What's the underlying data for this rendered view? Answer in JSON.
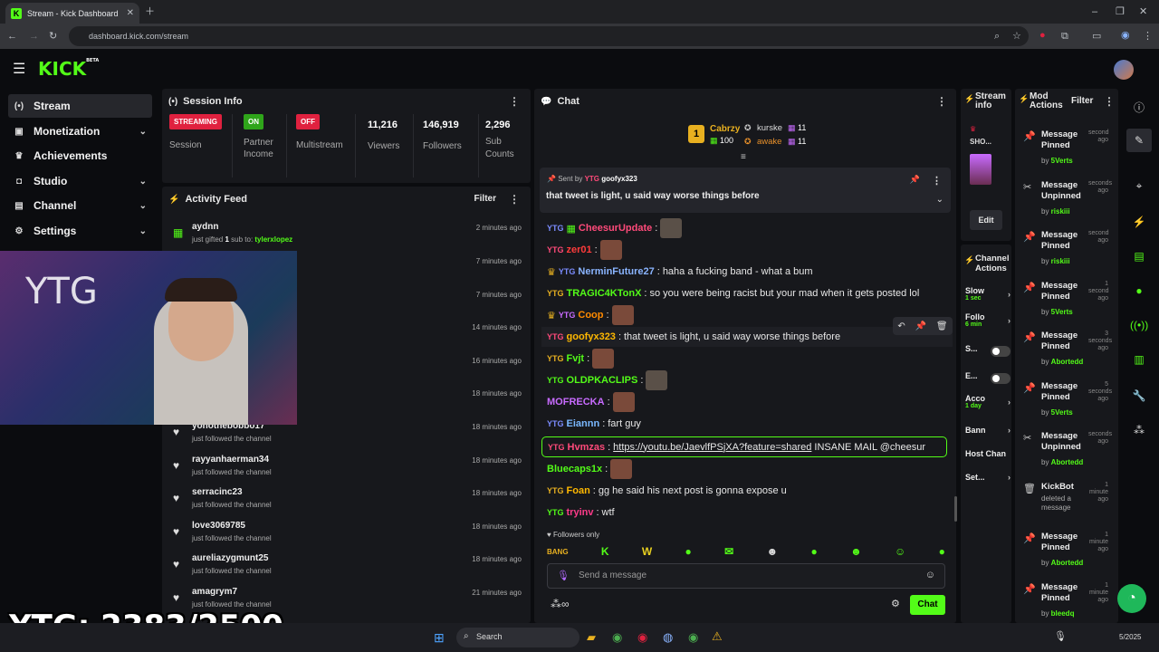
{
  "browser": {
    "tab_title": "Stream - Kick Dashboard",
    "url": "dashboard.kick.com/stream"
  },
  "app": {
    "logo": "KICK",
    "logo_badge": "BETA"
  },
  "nav": {
    "items": [
      {
        "label": "Stream",
        "icon": "broadcast-icon"
      },
      {
        "label": "Monetization",
        "icon": "wallet-icon"
      },
      {
        "label": "Achievements",
        "icon": "trophy-icon"
      },
      {
        "label": "Studio",
        "icon": "studio-icon"
      },
      {
        "label": "Channel",
        "icon": "channel-icon"
      },
      {
        "label": "Settings",
        "icon": "gear-icon"
      }
    ]
  },
  "session": {
    "title": "Session Info",
    "cells": [
      {
        "badge": "STREAMING",
        "badge_color": "#e0213f",
        "label": "Session"
      },
      {
        "badge": "ON",
        "badge_color": "#2fa51a",
        "label": "Partner Income"
      },
      {
        "badge": "OFF",
        "badge_color": "#e0213f",
        "label": "Multistream"
      },
      {
        "value": "11,216",
        "label": "Viewers"
      },
      {
        "value": "146,919",
        "label": "Followers"
      },
      {
        "value": "2,296",
        "label": "Sub Counts"
      }
    ]
  },
  "activity": {
    "title": "Activity Feed",
    "filter": "Filter",
    "items": [
      {
        "name": "aydnn",
        "sub_pre": "just gifted ",
        "sub_count": "1",
        "sub_mid": " sub to: ",
        "sub_target": "tylerxlopez",
        "time": "2 minutes ago"
      },
      {
        "time": "7 minutes ago"
      },
      {
        "time": "7 minutes ago"
      },
      {
        "time": "14 minutes ago"
      },
      {
        "time": "16 minutes ago"
      },
      {
        "time": "18 minutes ago"
      },
      {
        "name": "yohothebobbo17",
        "sub": "just followed the channel",
        "time": "18 minutes ago"
      },
      {
        "name": "rayyanhaerman34",
        "sub": "just followed the channel",
        "time": "18 minutes ago"
      },
      {
        "name": "serracinc23",
        "sub": "just followed the channel",
        "time": "18 minutes ago"
      },
      {
        "name": "love3069785",
        "sub": "just followed the channel",
        "time": "18 minutes ago"
      },
      {
        "name": "aureliazygmunt25",
        "sub": "just followed the channel",
        "time": "18 minutes ago"
      },
      {
        "name": "amagrym7",
        "sub": "just followed the channel",
        "time": "21 minutes ago"
      }
    ]
  },
  "chat": {
    "title": "Chat",
    "top_gifters": [
      {
        "name": "Cabrzy",
        "count": "100"
      },
      {
        "name": "kurske",
        "count": "11"
      },
      {
        "name": "awake",
        "count": "11"
      }
    ],
    "pinned": {
      "sent_by_label": "Sent by",
      "sender": "goofyx323",
      "message": "that tweet is light, u said way worse things before"
    },
    "messages": [
      {
        "user": "CheesurUpdate",
        "color": "#ff4a7a",
        "text": "",
        "emote": true
      },
      {
        "user": "zer01",
        "color": "#ff3b3b",
        "text": "",
        "emote": true
      },
      {
        "user": "NerminFuture27",
        "color": "#8ab4ff",
        "text": "haha a fucking band - what a bum"
      },
      {
        "user": "TRAGIC4KTonX",
        "color": "#53fc18",
        "text": "so you were being racist but your mad when it gets posted lol"
      },
      {
        "user": "Coop",
        "color": "#ff8a00",
        "text": "",
        "emote": true
      },
      {
        "user": "goofyx323",
        "color": "#ffb800",
        "text": "that tweet is light, u said way worse things before"
      },
      {
        "user": "Fvjt",
        "color": "#53fc18",
        "text": "",
        "emote": true
      },
      {
        "user": "OLDPKACLIPS",
        "color": "#53fc18",
        "text": "",
        "emote": true
      },
      {
        "user": "MOFRECKA",
        "color": "#c86bff",
        "text": "",
        "emote": true
      },
      {
        "user": "Eiannn",
        "color": "#7ab8ff",
        "text": "fart guy"
      },
      {
        "user": "Hvmzas",
        "color": "#ff4a7a",
        "link": "https://youtu.be/JaevlfPSjXA?feature=shared",
        "text": "INSANE MAIL @cheesur"
      },
      {
        "user": "Bluecaps1x",
        "color": "#53fc18",
        "text": "",
        "emote": true
      },
      {
        "user": "Foan",
        "color": "#ffb800",
        "text": "gg he said his next post is gonna expose u"
      },
      {
        "user": "tryinv",
        "color": "#ff3b8a",
        "text": "wtf"
      }
    ],
    "followers_only": "Followers only",
    "input_placeholder": "Send a message",
    "send_button": "Chat"
  },
  "stream_info": {
    "title": "Stream info",
    "snippet": "SHO...",
    "edit": "Edit"
  },
  "channel_actions": {
    "title": "Channel Actions",
    "controls": [
      {
        "label": "Slow",
        "value": "1 sec",
        "kind": "arrow"
      },
      {
        "label": "Follo",
        "value": "6 min",
        "kind": "arrow"
      },
      {
        "label": "S...",
        "kind": "toggle"
      },
      {
        "label": "E...",
        "kind": "toggle"
      },
      {
        "label": "Acco",
        "value": "1 day",
        "kind": "arrow"
      },
      {
        "label": "Bann",
        "kind": "arrow"
      },
      {
        "label": "Host Chan",
        "kind": "none"
      },
      {
        "label": "Set...",
        "kind": "arrow"
      }
    ]
  },
  "mod_actions": {
    "title": "Mod Actions",
    "filter": "Filter",
    "items": [
      {
        "action": "Message Pinned",
        "by": "5Verts",
        "time": "second ago",
        "icon": "pin-icon"
      },
      {
        "action": "Message Unpinned",
        "by": "riskiii",
        "time": "seconds ago",
        "icon": "unpin-icon"
      },
      {
        "action": "Message Pinned",
        "by": "riskiii",
        "time": "second ago",
        "icon": "pin-icon"
      },
      {
        "action": "Message Pinned",
        "by": "5Verts",
        "time": "1 second ago",
        "icon": "pin-icon"
      },
      {
        "action": "Message Pinned",
        "by": "Abortedd",
        "time": "3 seconds ago",
        "icon": "pin-icon"
      },
      {
        "action": "Message Pinned",
        "by": "5Verts",
        "time": "5 seconds ago",
        "icon": "pin-icon"
      },
      {
        "action": "Message Unpinned",
        "by": "Abortedd",
        "time": "seconds ago",
        "icon": "unpin-icon"
      },
      {
        "action": "KickBot",
        "sub": "deleted a message",
        "time": "1 minute ago",
        "icon": "trash-icon"
      },
      {
        "action": "Message Pinned",
        "by": "Abortedd",
        "time": "1 minute ago",
        "icon": "pin-icon"
      },
      {
        "action": "Message Pinned",
        "by": "bleedq",
        "time": "1 minute ago",
        "icon": "pin-icon"
      }
    ]
  },
  "overlay": {
    "counter": "YTG: 2383/2500",
    "webcam_text": "YTG"
  },
  "taskbar": {
    "search": "Search",
    "clock": "5/2025"
  }
}
